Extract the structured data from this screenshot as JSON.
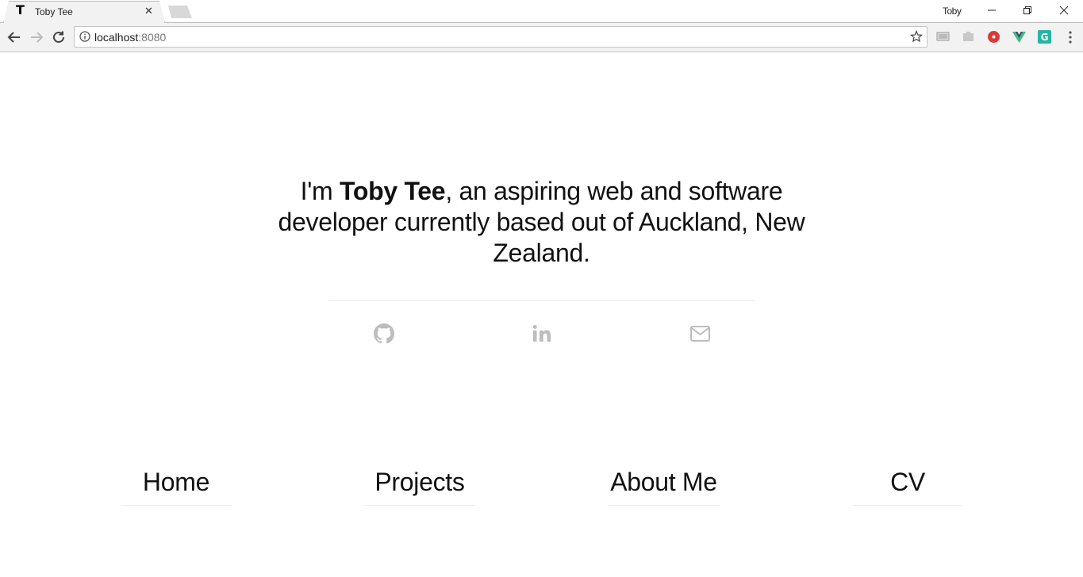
{
  "browser": {
    "tab_title": "Toby Tee",
    "tab_favicon": "T",
    "tab_close": "✕",
    "profile_name": "Toby",
    "url_host": "localhost",
    "url_port": ":8080",
    "window_controls": {
      "minimize": "—",
      "restore": "❐",
      "close": "✕"
    }
  },
  "hero": {
    "prefix": "I'm ",
    "name": "Toby Tee",
    "rest": ", an aspiring web and software developer currently based out of Auckland, New Zealand."
  },
  "social": {
    "items": [
      {
        "icon": "github-icon"
      },
      {
        "icon": "linkedin-icon"
      },
      {
        "icon": "envelope-icon"
      }
    ],
    "icon_color": "#bdbdbd"
  },
  "nav": {
    "items": [
      {
        "label": "Home"
      },
      {
        "label": "Projects"
      },
      {
        "label": "About Me"
      },
      {
        "label": "CV"
      }
    ]
  },
  "colors": {
    "text": "#111111",
    "divider": "#ebebeb",
    "chrome_bg": "#f2f2f2"
  }
}
